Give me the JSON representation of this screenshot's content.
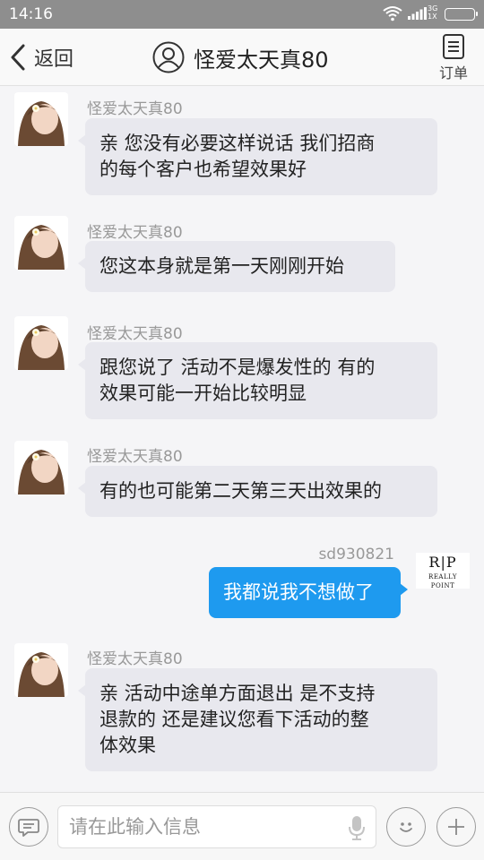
{
  "status_bar": {
    "time": "14:16",
    "network_top": "3G",
    "network_bottom": "1X"
  },
  "header": {
    "back_label": "返回",
    "title": "怪爱太天真80",
    "order_label": "订单"
  },
  "messages": [
    {
      "sender": "怪爱太天真80",
      "lines": [
        "亲 您没有必要这样说话 我们招商",
        "的每个客户也希望效果好"
      ]
    },
    {
      "sender": "怪爱太天真80",
      "lines": [
        "您这本身就是第一天刚刚开始"
      ]
    },
    {
      "sender": "怪爱太天真80",
      "lines": [
        "跟您说了 活动不是爆发性的 有的",
        "效果可能一开始比较明显"
      ]
    },
    {
      "sender": "怪爱太天真80",
      "lines": [
        "有的也可能第二天第三天出效果的"
      ]
    },
    {
      "sender": "sd930821",
      "lines": [
        "我都说我不想做了"
      ]
    },
    {
      "sender": "怪爱太天真80",
      "lines": [
        "亲  活动中途单方面退出  是不支持",
        "退款的 还是建议您看下活动的整",
        "体效果"
      ]
    }
  ],
  "watermark": {
    "big": "R|P",
    "small": "REALLY POINT"
  },
  "input": {
    "placeholder": "请在此输入信息",
    "value": ""
  },
  "colors": {
    "outgoing_bubble": "#1e9aef",
    "incoming_bubble": "#e8e8ee",
    "status_bar": "#8e8e8e"
  }
}
